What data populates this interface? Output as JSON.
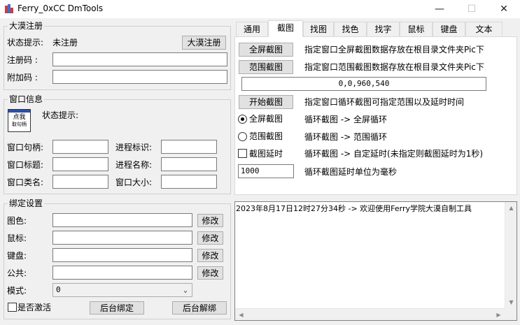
{
  "window": {
    "title": "Ferry_0xCC DmTools",
    "minimize": "—",
    "maximize": "☐",
    "close": "✕"
  },
  "register": {
    "group_title": "大漠注册",
    "status_label": "状态提示:",
    "status_value": "未注册",
    "register_button": "大漠注册",
    "code_label": "注册码 :",
    "code_value": "",
    "extra_label": "附加码 :",
    "extra_value": ""
  },
  "window_info": {
    "group_title": "窗口信息",
    "finder_icon_line1": "点我",
    "finder_icon_line2": "取句柄",
    "status_label": "状态提示:",
    "handle_label": "窗口句柄:",
    "handle_value": "",
    "pid_label": "进程标识:",
    "pid_value": "",
    "title_label": "窗口标题:",
    "title_value": "",
    "process_label": "进程名称:",
    "process_value": "",
    "class_label": "窗口类名:",
    "class_value": "",
    "size_label": "窗口大小:",
    "size_value": ""
  },
  "bind": {
    "group_title": "绑定设置",
    "display_label": "图色:",
    "mouse_label": "鼠标:",
    "keypad_label": "键盘:",
    "public_label": "公共:",
    "display_value": "",
    "mouse_value": "",
    "keypad_value": "",
    "public_value": "",
    "modify_label": "修改",
    "mode_label": "模式:",
    "mode_value": "0",
    "activate_label": "是否激活",
    "bind_button": "后台绑定",
    "unbind_button": "后台解绑"
  },
  "tabs": [
    "通用",
    "截图",
    "找图",
    "找色",
    "找字",
    "鼠标",
    "键盘",
    "文本"
  ],
  "active_tab": 1,
  "screenshot": {
    "fullscreen_button": "全屏截图",
    "fullscreen_desc": "指定窗口全屏截图数据存放在根目录文件夹Pic下",
    "range_button": "范围截图",
    "range_desc": "指定窗口范围截图数据存放在根目录文件夹Pic下",
    "range_value": "0,0,960,540",
    "start_button": "开始截图",
    "start_desc": "指定窗口循环截图可指定范围以及延时时间",
    "radio_full_label": "全屏截图",
    "radio_full_desc": "循环截图 -> 全屏循环",
    "radio_range_label": "范围截图",
    "radio_range_desc": "循环截图 -> 范围循环",
    "delay_label": "截图延时",
    "delay_desc": "循环截图 -> 自定延时(未指定则截图延时为1秒)",
    "delay_value": "1000",
    "delay_unit_desc": "循环截图延时单位为毫秒"
  },
  "log": {
    "line1": "2023年8月17日12时27分34秒 -> 欢迎使用Ferry学院大漠自制工具"
  }
}
